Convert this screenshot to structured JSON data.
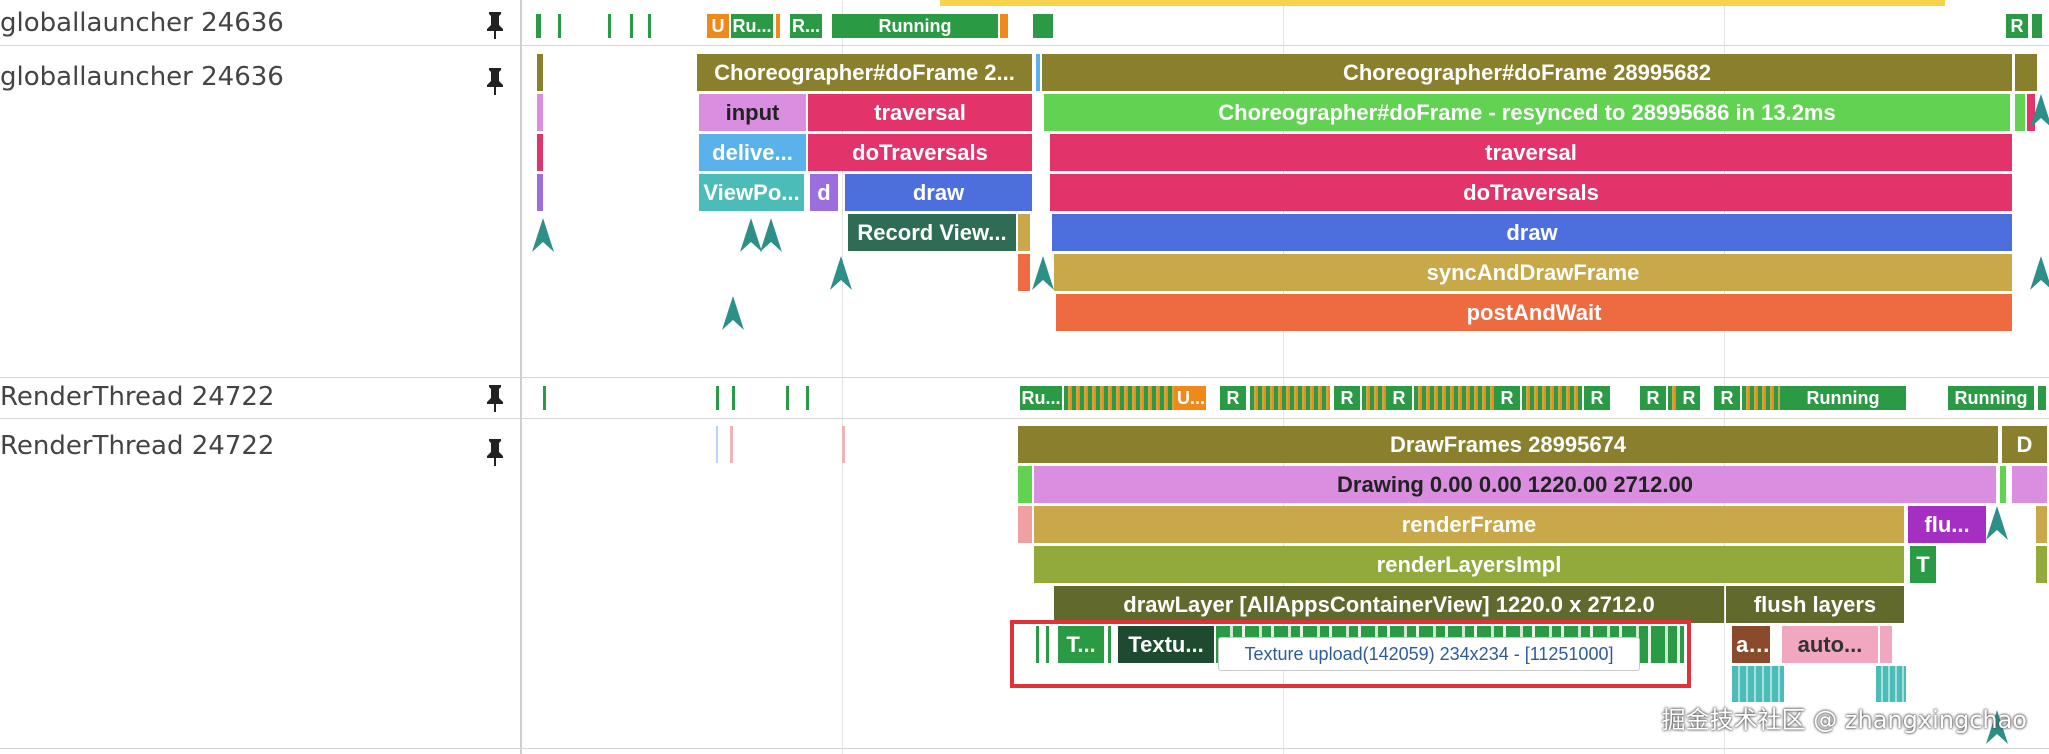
{
  "tracks": {
    "launcher_state": {
      "label": "globallauncher 24636",
      "states": [
        "U",
        "Ru...",
        "R...",
        "Running",
        "R"
      ]
    },
    "launcher_slices": {
      "label": "globallauncher 24636",
      "choreo_short": "Choreographer#doFrame 2...",
      "choreo_main": "Choreographer#doFrame 28995682",
      "input": "input",
      "traversal_left": "traversal",
      "resynced": "Choreographer#doFrame - resynced to 28995686 in 13.2ms",
      "deliver": "delive...",
      "dotraversals_left": "doTraversals",
      "traversal_main": "traversal",
      "viewpost": "ViewPo...",
      "d": "d",
      "draw_left": "draw",
      "dotraversals_main": "doTraversals",
      "record_view": "Record View...",
      "draw_main": "draw",
      "sync_and_draw": "syncAndDrawFrame",
      "post_and_wait": "postAndWait"
    },
    "render_state": {
      "label": "RenderThread 24722",
      "states": [
        "Ru...",
        "U...",
        "R",
        "R",
        "R",
        "R",
        "R",
        "R",
        "R",
        "R",
        "Running",
        "Running"
      ]
    },
    "render_slices": {
      "label": "RenderThread 24722",
      "draw_frames": "DrawFrames 28995674",
      "draw_frames_next": "D",
      "drawing": "Drawing  0.00  0.00 1220.00 2712.00",
      "render_frame": "renderFrame",
      "flu": "flu...",
      "render_layers": "renderLayersImpl",
      "t_small": "T",
      "draw_layer": "drawLayer [AllAppsContainerView] 1220.0 x 2712.0",
      "flush_layers": "flush layers",
      "t_left": "T...",
      "textu": "Textu...",
      "a_short": "a...",
      "auto": "auto..."
    }
  },
  "tooltip": "Texture upload(142059) 234x234 - [11251000]",
  "watermark": "掘金技术社区 @ zhangxingchao",
  "colors": {
    "olive": "#8a7f2c",
    "violet": "#d98ee0",
    "pink_red": "#e2336a",
    "sky": "#5ab2ea",
    "teal": "#4cbcb9",
    "purple": "#9c6ddc",
    "blue": "#4c6fdd",
    "dark_green": "#2f6c56",
    "green": "#62d252",
    "mustard": "#c9a84a",
    "orange_red": "#ee6a40",
    "olive_green": "#92a93c",
    "dark_olive": "#616a2c",
    "magenta": "#a42fc2",
    "running_green": "#2b9a45",
    "uninterruptible": "#ef8a1a"
  }
}
